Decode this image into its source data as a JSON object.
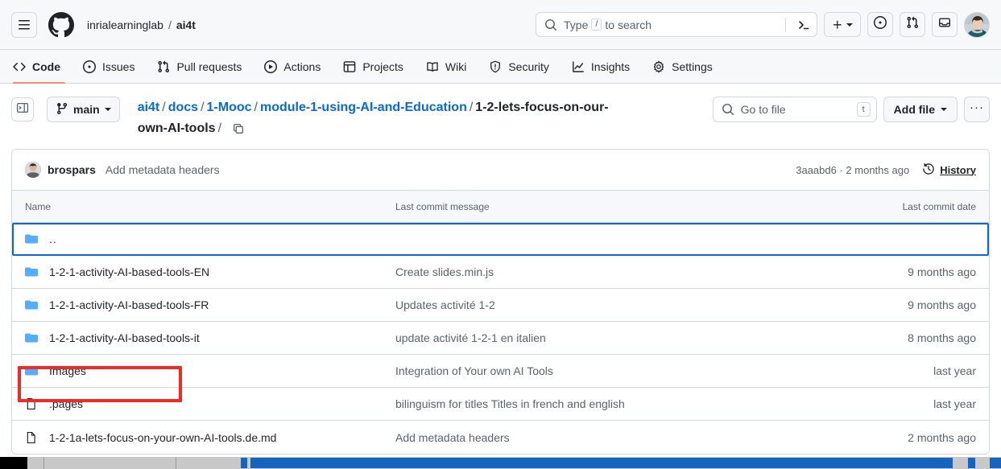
{
  "header": {
    "menu_icon": "hamburger-icon",
    "logo_icon": "github-logo-icon",
    "owner": "inrialearninglab",
    "separator": "/",
    "repo": "ai4t",
    "search": {
      "icon": "search-icon",
      "placeholder_prefix": "Type",
      "placeholder_key": "/",
      "placeholder_suffix": "to search",
      "terminal_icon": "terminal-icon"
    },
    "create_new_label": "+",
    "issues_icon": "issue-opened-icon",
    "pulls_icon": "git-pull-request-icon",
    "inbox_icon": "inbox-icon",
    "avatar": "user-avatar"
  },
  "nav": {
    "tabs": [
      {
        "label": "Code",
        "icon": "code-icon",
        "active": true
      },
      {
        "label": "Issues",
        "icon": "issue-opened-icon",
        "active": false
      },
      {
        "label": "Pull requests",
        "icon": "git-pull-request-icon",
        "active": false
      },
      {
        "label": "Actions",
        "icon": "play-icon",
        "active": false
      },
      {
        "label": "Projects",
        "icon": "table-icon",
        "active": false
      },
      {
        "label": "Wiki",
        "icon": "book-icon",
        "active": false
      },
      {
        "label": "Security",
        "icon": "shield-icon",
        "active": false
      },
      {
        "label": "Insights",
        "icon": "graph-icon",
        "active": false
      },
      {
        "label": "Settings",
        "icon": "gear-icon",
        "active": false
      }
    ],
    "active_underline_color": "#fd8c73"
  },
  "path_bar": {
    "sidebar_toggle_icon": "sidebar-expand-icon",
    "branch": "main",
    "branch_icon": "git-branch-icon",
    "crumbs_line1": [
      {
        "text": "ai4t",
        "link": true
      },
      {
        "text": "docs",
        "link": true
      },
      {
        "text": "1-Mooc",
        "link": true
      },
      {
        "text": "module-1-using-AI-and-Education",
        "link": true
      }
    ],
    "crumbs_line2_current": "1-2-lets-focus-on-our-own-AI-tools",
    "copy_path_icon": "copy-icon",
    "go_to_file_placeholder": "Go to file",
    "go_to_file_key": "t",
    "add_file_label": "Add file",
    "kebab_label": "···"
  },
  "commit_bar": {
    "author": "brospars",
    "message": "Add metadata headers",
    "hash": "3aaabd6",
    "separator": "·",
    "relative_time": "2 months ago",
    "history_label": "History",
    "history_icon": "history-icon"
  },
  "table": {
    "columns": {
      "name": "Name",
      "message": "Last commit message",
      "date": "Last commit date"
    },
    "rows": [
      {
        "name": "..",
        "icon": "folder-icon",
        "message": "",
        "date": "",
        "focused": true
      },
      {
        "name": "1-2-1-activity-AI-based-tools-EN",
        "icon": "folder-icon",
        "message": "Create slides.min.js",
        "date": "9 months ago",
        "focused": false
      },
      {
        "name": "1-2-1-activity-AI-based-tools-FR",
        "icon": "folder-icon",
        "message": "Updates activité 1-2",
        "date": "9 months ago",
        "focused": false
      },
      {
        "name": "1-2-1-activity-AI-based-tools-it",
        "icon": "folder-icon",
        "message": "update activité 1-2-1 en italien",
        "date": "8 months ago",
        "focused": false
      },
      {
        "name": "Images",
        "icon": "folder-icon",
        "message": "Integration of Your own AI Tools",
        "date": "last year",
        "focused": false,
        "annotated": true
      },
      {
        "name": ".pages",
        "icon": "file-icon",
        "message": "bilinguism for titles Titles in french and english",
        "date": "last year",
        "focused": false
      },
      {
        "name": "1-2-1a-lets-focus-on-your-own-AI-tools.de.md",
        "icon": "file-icon",
        "message": "Add metadata headers",
        "date": "2 months ago",
        "focused": false
      }
    ]
  },
  "colors": {
    "link": "#0969da",
    "folder": "#54aeff",
    "muted": "#59636e",
    "border": "#d1d9e0",
    "header_bg": "#f6f8fa",
    "active_tab": "#fd8c73",
    "annotation": "#ee2b26",
    "focus_outline": "#0969da",
    "scrollbar_thumb": "#1565c0"
  }
}
